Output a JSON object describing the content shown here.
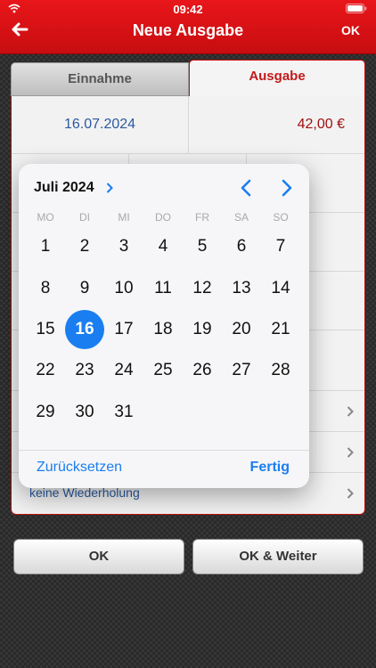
{
  "status": {
    "time": "09:42"
  },
  "nav": {
    "title": "Neue Ausgabe",
    "ok": "OK"
  },
  "tabs": [
    {
      "label": "Einnahme"
    },
    {
      "label": "Ausgabe",
      "selected": true
    }
  ],
  "form": {
    "date": "16.07.2024",
    "amount": "42,00  €",
    "repeat": "keine Wiederholung"
  },
  "buttons": {
    "ok": "OK",
    "ok_next": "OK & Weiter"
  },
  "picker": {
    "month_label": "Juli 2024",
    "weekdays": [
      "MO",
      "DI",
      "MI",
      "DO",
      "FR",
      "SA",
      "SO"
    ],
    "days": [
      "1",
      "2",
      "3",
      "4",
      "5",
      "6",
      "7",
      "8",
      "9",
      "10",
      "11",
      "12",
      "13",
      "14",
      "15",
      "16",
      "17",
      "18",
      "19",
      "20",
      "21",
      "22",
      "23",
      "24",
      "25",
      "26",
      "27",
      "28",
      "29",
      "30",
      "31"
    ],
    "selected_day": "16",
    "reset": "Zurücksetzen",
    "done": "Fertig"
  },
  "colors": {
    "accent": "#1a7ef0",
    "nav": "#d61014",
    "expense": "#c21a1a"
  },
  "icons": [
    "wifi-icon",
    "battery-icon",
    "back-arrow-icon",
    "chevron-right-icon",
    "chevron-left-icon"
  ]
}
